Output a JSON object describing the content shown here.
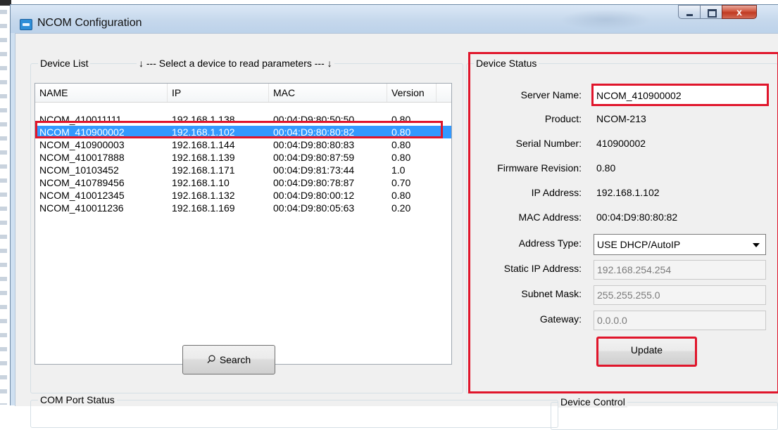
{
  "window": {
    "title": "NCOM Configuration",
    "close_glyph": "x"
  },
  "device_list": {
    "group_title": "Device List",
    "hint": "↓ --- Select a device to read parameters --- ↓",
    "columns": [
      "NAME",
      "IP",
      "MAC",
      "Version"
    ],
    "rows": [
      {
        "name": "NCOM_410011111",
        "ip": "192.168.1.138",
        "mac": "00:04:D9:80:50:50",
        "version": "0.80"
      },
      {
        "name": "NCOM_410900002",
        "ip": "192.168.1.102",
        "mac": "00:04:D9:80:80:82",
        "version": "0.80"
      },
      {
        "name": "NCOM_410900003",
        "ip": "192.168.1.144",
        "mac": "00:04:D9:80:80:83",
        "version": "0.80"
      },
      {
        "name": "NCOM_410017888",
        "ip": "192.168.1.139",
        "mac": "00:04:D9:80:87:59",
        "version": "0.80"
      },
      {
        "name": "NCOM_10103452",
        "ip": "192.168.1.171",
        "mac": "00:04:D9:81:73:44",
        "version": "1.0"
      },
      {
        "name": "NCOM_410789456",
        "ip": "192.168.1.10",
        "mac": "00:04:D9:80:78:87",
        "version": "0.70"
      },
      {
        "name": "NCOM_410012345",
        "ip": "192.168.1.132",
        "mac": "00:04:D9:80:00:12",
        "version": "0.80"
      },
      {
        "name": "NCOM_410011236",
        "ip": "192.168.1.169",
        "mac": "00:04:D9:80:05:63",
        "version": "0.20"
      }
    ],
    "selected_index": 1,
    "search_label": "Search",
    "search_icon": "search-icon"
  },
  "device_status": {
    "group_title": "Device Status",
    "server_name_label": "Server Name:",
    "server_name_value": "NCOM_410900002",
    "product_label": "Product:",
    "product_value": "NCOM-213",
    "serial_label": "Serial Number:",
    "serial_value": "410900002",
    "firmware_label": "Firmware Revision:",
    "firmware_value": "0.80",
    "ip_label": "IP Address:",
    "ip_value": "192.168.1.102",
    "mac_label": "MAC Address:",
    "mac_value": "00:04:D9:80:80:82",
    "address_type_label": "Address Type:",
    "address_type_value": "USE DHCP/AutoIP",
    "static_ip_label": "Static IP Address:",
    "static_ip_value": "192.168.254.254",
    "subnet_label": "Subnet Mask:",
    "subnet_value": "255.255.255.0",
    "gateway_label": "Gateway:",
    "gateway_value": "0.0.0.0",
    "update_label": "Update"
  },
  "com_port_status": {
    "group_title": "COM Port Status"
  },
  "device_control": {
    "group_title": "Device Control"
  },
  "colors": {
    "selection": "#3399ff",
    "highlight": "#e0152b"
  }
}
